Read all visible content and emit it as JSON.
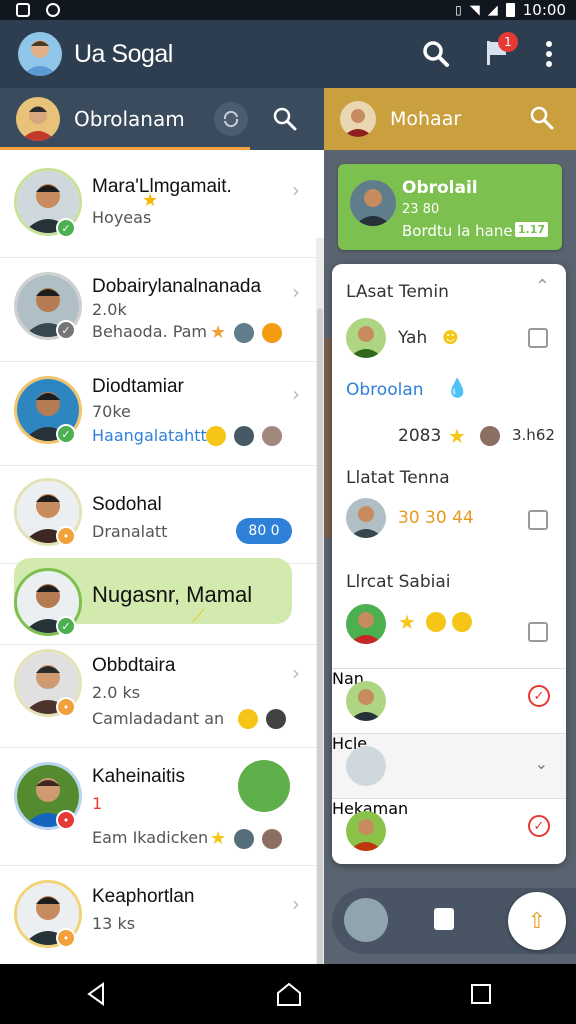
{
  "status_bar": {
    "time": "10:00"
  },
  "app_bar": {
    "title": "Ua Sogal",
    "notification_count": "1"
  },
  "left_panel": {
    "title": "Obrolanam",
    "chats": [
      {
        "name": "Mara'Llmgamait.",
        "subtitle": "Hoyeas"
      },
      {
        "name": "Dobairylanalnanada",
        "meta": "2.0k",
        "subtitle": "Behaoda. Pam"
      },
      {
        "name": "Diodtamiar",
        "meta": "70ke",
        "subtitle": "Haangalatahtt"
      },
      {
        "name": "Sodohal",
        "subtitle": "Dranalatt",
        "badge": "80 0"
      },
      {
        "name": "Nugasnr, Mamal"
      },
      {
        "name": "Obbdtaira",
        "meta": "2.0 ks",
        "subtitle": "Camladadant an"
      },
      {
        "name": "Kaheinaitis",
        "meta": "1",
        "subtitle": "Eam Ikadicken"
      },
      {
        "name": "Keaphortlan",
        "meta": "13 ks"
      }
    ]
  },
  "right_panel": {
    "title": "Mohaar",
    "group_card": {
      "title": "Obrolail",
      "line2": "23 80",
      "line3": "Bordtu la hane",
      "tag": "1.17"
    },
    "menu": {
      "items": [
        {
          "label": "LAsat Temin"
        },
        {
          "label": "Yah"
        },
        {
          "label": "Obroolan"
        },
        {
          "label": "2083",
          "extra": "3.h62"
        },
        {
          "label": "Llatat Tenna"
        },
        {
          "label": "30 30 44"
        },
        {
          "label": "Llrcat Sabiai"
        },
        {
          "label": "Nan"
        },
        {
          "label": "Hcle"
        },
        {
          "label": "Hekaman"
        }
      ]
    }
  },
  "colors": {
    "app_bar": "#2d3e50",
    "left_header": "#3a4b5e",
    "right_header": "#caa03f",
    "green": "#7cc04f",
    "online": "#4caf50",
    "away": "#f2a03a",
    "busy": "#e53935"
  }
}
